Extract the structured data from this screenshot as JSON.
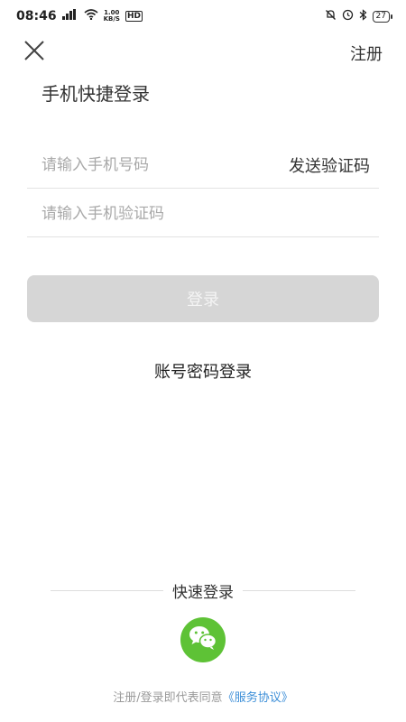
{
  "status_bar": {
    "time": "08:46",
    "signal": "4G",
    "net_speed_value": "1.00",
    "net_speed_unit": "KB/S",
    "hd": "HD",
    "battery": "27"
  },
  "header": {
    "register_label": "注册"
  },
  "title": "手机快捷登录",
  "form": {
    "phone_placeholder": "请输入手机号码",
    "send_code_label": "发送验证码",
    "code_placeholder": "请输入手机验证码",
    "login_label": "登录"
  },
  "password_login_label": "账号密码登录",
  "quick_login": {
    "label": "快速登录"
  },
  "agreement": {
    "text": "注册/登录即代表同意",
    "link": "《服务协议》"
  },
  "colors": {
    "wechat_green": "#5ec236",
    "link_blue": "#3d8fd8",
    "disabled_button": "#d6d6d6"
  }
}
